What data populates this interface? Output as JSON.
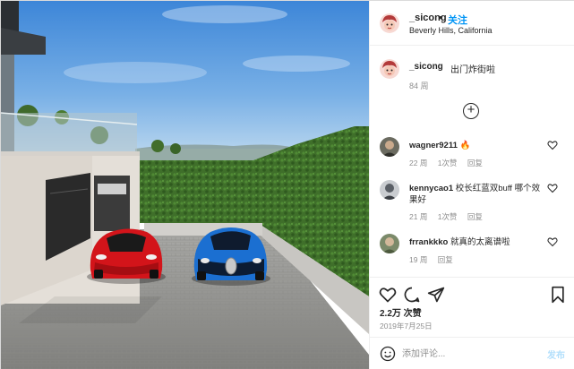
{
  "post": {
    "username": "_sicong",
    "separator": "•",
    "follow_label": "关注",
    "location": "Beverly Hills, California",
    "caption_text": "出门炸街啦",
    "caption_time": "84 周",
    "likes": "2.2万 次赞",
    "date": "2019年7月25日"
  },
  "comments": [
    {
      "user": "wagner9211",
      "text": "🔥",
      "time": "22 周",
      "likes": "1次赞",
      "reply": "回复"
    },
    {
      "user": "kennycao1",
      "text": "校长红蓝双buff 哪个效果好",
      "time": "21 周",
      "likes": "1次赞",
      "reply": "回复"
    },
    {
      "user": "frrankkko",
      "text": "就真的太离谱啦",
      "time": "19 周",
      "likes": "",
      "reply": "回复"
    }
  ],
  "add_comment": {
    "placeholder": "添加评论...",
    "post_label": "发布"
  },
  "icons": {
    "more": "plus-circle-icon",
    "like": "heart-icon",
    "comment": "comment-icon",
    "share": "send-icon",
    "save": "bookmark-icon",
    "emoji": "emoji-icon"
  },
  "colors": {
    "accent": "#0095f6",
    "post_disabled": "#b2dffc",
    "muted": "#8e8e8e",
    "car_left": "#d3141a",
    "car_right": "#1b6fd1"
  }
}
